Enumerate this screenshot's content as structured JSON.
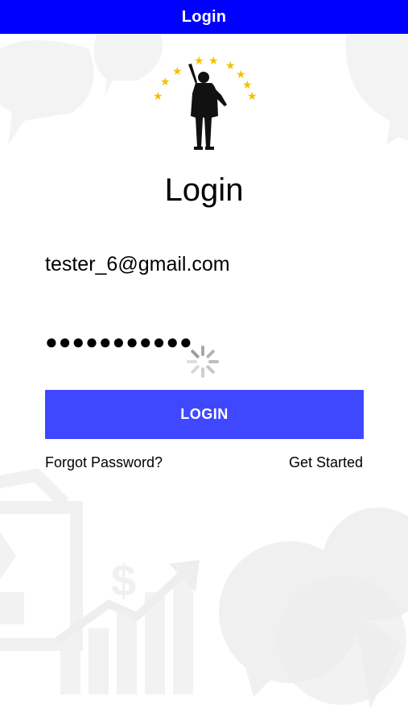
{
  "nav": {
    "title": "Login"
  },
  "logo": {
    "icon": "person-reaching-stars-logo",
    "star_color": "#f2c100"
  },
  "page_title": "Login",
  "email": {
    "value": "tester_6@gmail.com"
  },
  "password": {
    "value": "●●●●●●●●●●●"
  },
  "spinner": {
    "icon": "loading-spinner-icon"
  },
  "login_button": {
    "label": "LOGIN",
    "color": "#3f48ff"
  },
  "links": {
    "forgot_password": "Forgot Password?",
    "get_started": "Get Started"
  },
  "colors": {
    "nav_bar": "#0000ff",
    "background_watermark": "#f2f2f2"
  }
}
